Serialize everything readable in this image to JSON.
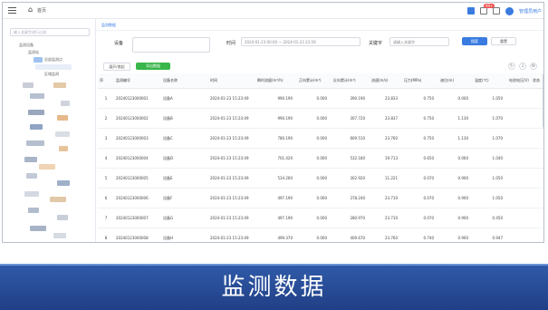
{
  "topbar": {
    "home_label": "首页",
    "badge": "99+",
    "user": "管理员用户"
  },
  "sidebar": {
    "search_placeholder": "输入关键字进行过滤",
    "items": [
      "监测设备",
      "监测站",
      "总部监测点",
      "区域监测"
    ]
  },
  "tab": {
    "label": "监测数据"
  },
  "filter": {
    "device_label": "设备",
    "time_label": "时间",
    "time_range": "2024-01-23 00:00 — 2024-01-23 23:59",
    "keyword_label": "关键字",
    "keyword_placeholder": "请输入关键字",
    "search_button": "搜索",
    "reset_button": "重置"
  },
  "toolbar": {
    "collapse_button": "展开/收起",
    "export_button": "导出数据"
  },
  "table": {
    "headers": [
      "序",
      "监测编号",
      "设备名称",
      "时间",
      "瞬时流量(m³/h)",
      "正向累计(m³)",
      "反向累计(m³)",
      "流速(m/s)",
      "压力(MPa)",
      "液位(m)",
      "温度(℃)",
      "电池电压(V)",
      "状态"
    ],
    "rows": [
      [
        "1",
        "20240123000001",
        "设备A",
        "2024-01-23 15:23:49",
        "990.190",
        "0.000",
        "390.190",
        "23.833",
        "0.750",
        "0.000",
        "1.050"
      ],
      [
        "2",
        "20240123000002",
        "设备B",
        "2024-01-23 15:23:49",
        "990.190",
        "0.000",
        "307.720",
        "23.837",
        "0.750",
        "1.130",
        "1.070"
      ],
      [
        "3",
        "20240123000003",
        "设备C",
        "2024-01-23 15:23:49",
        "780.190",
        "0.000",
        "669.510",
        "23.760",
        "0.750",
        "1.130",
        "1.070"
      ],
      [
        "4",
        "20240123000004",
        "设备D",
        "2024-01-23 15:23:49",
        "701.420",
        "0.000",
        "532.180",
        "19.713",
        "0.650",
        "0.060",
        "1.040"
      ],
      [
        "5",
        "20240123000005",
        "设备E",
        "2024-01-23 15:23:49",
        "534.260",
        "0.000",
        "302.920",
        "11.221",
        "0.070",
        "0.900",
        "1.050"
      ],
      [
        "6",
        "20240123000006",
        "设备F",
        "2024-01-23 15:23:49",
        "497.190",
        "0.000",
        "378.240",
        "23.710",
        "0.070",
        "0.900",
        "1.050"
      ],
      [
        "7",
        "20240123000007",
        "设备G",
        "2024-01-23 15:23:49",
        "497.190",
        "0.000",
        "280.970",
        "23.710",
        "0.070",
        "0.900",
        "0.450"
      ],
      [
        "8",
        "20240123000008",
        "设备H",
        "2024-01-23 15:23:49",
        "499.370",
        "0.000",
        "409.670",
        "23.760",
        "0.740",
        "0.900",
        "0.947"
      ]
    ]
  },
  "caption": "监测数据"
}
